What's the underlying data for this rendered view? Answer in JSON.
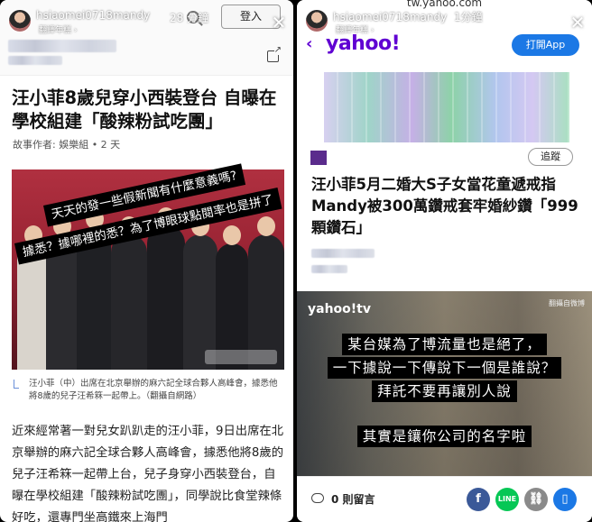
{
  "left_story": {
    "username": "hsiaomei0718mandy",
    "time": "28 分鐘",
    "sub": "翻譯年糕 ›",
    "login_label": "登入",
    "article": {
      "title": "汪小菲8歲兒穿小西裝登台 自曝在學校組建「酸辣粉試吃團」",
      "byline": "故事作者: 娛樂組 • 2 天",
      "sticker_line1": "天天的發一些假新聞有什麼意義嗎?",
      "sticker_line2": "據悉？據哪裡的悉？為了博眼球點閱率也是拼了",
      "caption": "汪小菲（中）出席在北京舉辦的麻六記全球合夥人高峰會，據悉他將8歲的兒子汪希箖一起帶上。（翻攝自網路）",
      "body": "近來經常著一對兒女趴趴走的汪小菲，9日出席在北京舉辦的麻六記全球合夥人高峰會，據悉他將8歲的兒子汪希箖一起帶上台，兒子身穿小西裝登台，自曝在學校組建「酸辣粉試吃團」，同學說比食堂辣條好吃，還專門坐高鐵來上海門"
    }
  },
  "right_story": {
    "url": "tw.yahoo.com",
    "username": "hsiaomei0718mandy",
    "time": "1分鐘",
    "sub": "翻譯年糕 ›",
    "logo": "yahoo!",
    "open_app_label": "打開App",
    "follow_label": "追蹤",
    "title": "汪小菲5月二婚大S子女當花童遞戒指 Mandy被300萬鑽戒套牢婚紗鑽「999顆鑽石」",
    "video": {
      "logo": "yahoo!tv",
      "corner": "翻攝自微博",
      "sub_line1": "某台媒為了博流量也是絕了，",
      "sub_line2": "一下據說一下傳說下一個是誰說？",
      "sub_line3": "拜託不要再讓別人說",
      "sub_line4": "其實是鑲你公司的名字啦"
    },
    "comments_label": "0 則留言"
  },
  "colors": {
    "yahoo_purple": "#6001d2",
    "app_blue": "#1b78e5",
    "facebook": "#3b5998",
    "line": "#06c755",
    "link": "#8a8a8a",
    "bookmark": "#1b78e5"
  }
}
